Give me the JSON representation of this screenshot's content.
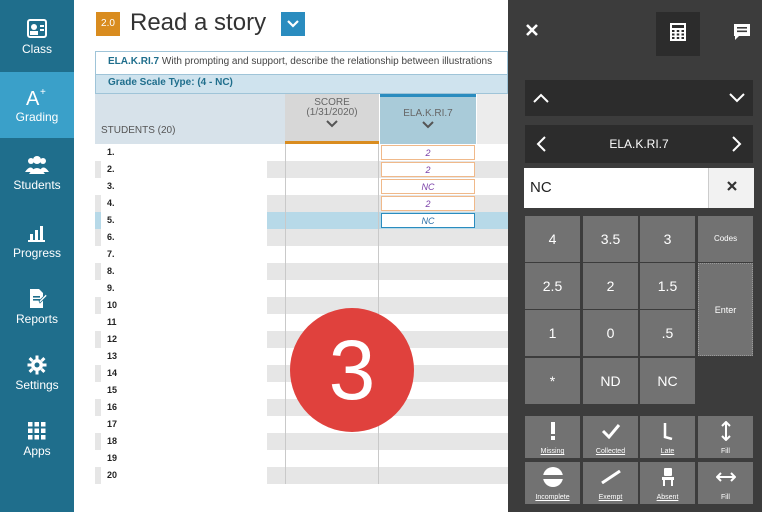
{
  "nav": {
    "items": [
      {
        "label": "Class",
        "icon": "class-icon"
      },
      {
        "label": "Grading",
        "icon": "grading-icon"
      },
      {
        "label": "Students",
        "icon": "students-icon"
      },
      {
        "label": "Progress",
        "icon": "progress-icon"
      },
      {
        "label": "Reports",
        "icon": "reports-icon"
      },
      {
        "label": "Settings",
        "icon": "settings-icon"
      },
      {
        "label": "Apps",
        "icon": "apps-icon"
      }
    ],
    "active": "Grading"
  },
  "header": {
    "badge": "2.0",
    "title": "Read a story"
  },
  "standard": {
    "code": "ELA.K.RI.7",
    "description": "With prompting and support, describe the relationship between illustrations"
  },
  "scale": {
    "label": "Grade Scale Type:",
    "value": "(4 - NC)"
  },
  "grid": {
    "students_header": "STUDENTS (20)",
    "score_header": "SCORE\n(1/31/2020)",
    "standard_header": "ELA.K.RI.7",
    "rows": [
      {
        "num": "1.",
        "value": "2"
      },
      {
        "num": "2.",
        "value": "2"
      },
      {
        "num": "3.",
        "value": "NC"
      },
      {
        "num": "4.",
        "value": "2"
      },
      {
        "num": "5.",
        "value": "NC"
      },
      {
        "num": "6.",
        "value": ""
      },
      {
        "num": "7.",
        "value": ""
      },
      {
        "num": "8.",
        "value": ""
      },
      {
        "num": "9.",
        "value": ""
      },
      {
        "num": "10",
        "value": ""
      },
      {
        "num": "11",
        "value": ""
      },
      {
        "num": "12",
        "value": ""
      },
      {
        "num": "13",
        "value": ""
      },
      {
        "num": "14",
        "value": ""
      },
      {
        "num": "15",
        "value": ""
      },
      {
        "num": "16",
        "value": ""
      },
      {
        "num": "17",
        "value": ""
      },
      {
        "num": "18",
        "value": ""
      },
      {
        "num": "19",
        "value": ""
      },
      {
        "num": "20",
        "value": ""
      }
    ],
    "selected_row": 5
  },
  "overlay_badge": "3",
  "panel": {
    "standard": "ELA.K.RI.7",
    "input_value": "NC",
    "keys": [
      "4",
      "3.5",
      "3",
      "Codes",
      "2.5",
      "2",
      "1.5",
      "Enter",
      "1",
      "0",
      ".5",
      "*",
      "ND",
      "NC"
    ],
    "actions": [
      {
        "label": "Missing",
        "icon": "missing-icon"
      },
      {
        "label": "Collected",
        "icon": "checkmark-icon"
      },
      {
        "label": "Late",
        "icon": "late-icon"
      },
      {
        "label": "Fill",
        "icon": "fill-vertical-icon"
      },
      {
        "label": "Incomplete",
        "icon": "incomplete-icon"
      },
      {
        "label": "Exempt",
        "icon": "exempt-icon"
      },
      {
        "label": "Absent",
        "icon": "absent-icon"
      },
      {
        "label": "Fill",
        "icon": "fill-horizontal-icon"
      }
    ]
  },
  "colors": {
    "nav_bg": "#1f6e8c",
    "nav_active": "#3aa0c9",
    "accent_orange": "#d98c1f",
    "accent_blue": "#2a8cbf",
    "badge_red": "#e0413d",
    "panel_bg": "#3c3c3c",
    "key_bg": "#727272"
  }
}
